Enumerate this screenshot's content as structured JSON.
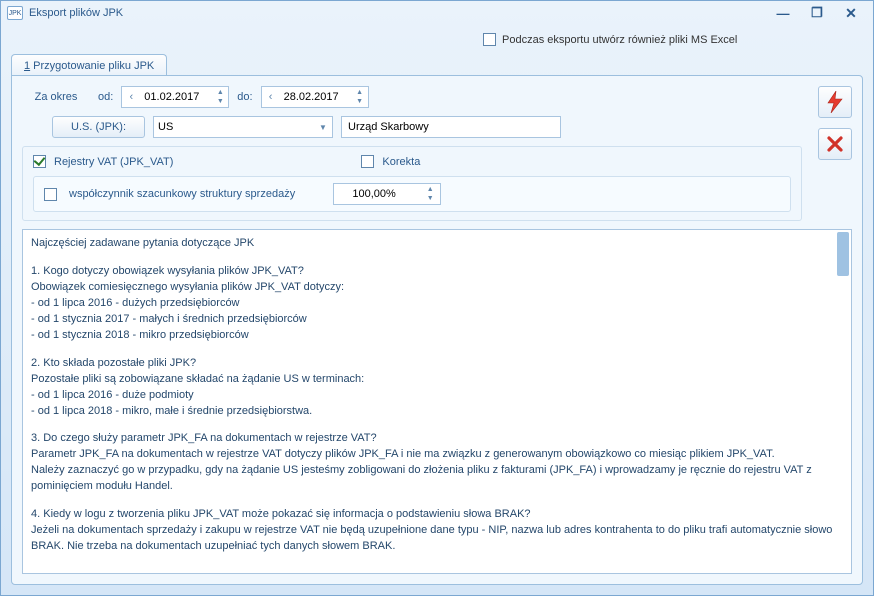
{
  "window": {
    "title": "Eksport plików JPK",
    "app_icon_text": "JPK"
  },
  "export_excel_label": "Podczas eksportu utwórz również pliki MS Excel",
  "tab": {
    "num": "1",
    "label": " Przygotowanie pliku JPK"
  },
  "period": {
    "label": "Za okres",
    "from_label": "od:",
    "from_value": "01.02.2017",
    "to_label": "do:",
    "to_value": "28.02.2017"
  },
  "us": {
    "button": "U.S. (JPK):",
    "code": "US",
    "name": "Urząd Skarbowy"
  },
  "registers": {
    "vat_label": "Rejestry VAT (JPK_VAT)",
    "correction_label": " Korekta",
    "ratio_label": "współczynnik szacunkowy struktury sprzedaży",
    "ratio_value": "100,00%"
  },
  "faq": {
    "heading": "Najczęściej zadawane pytania dotyczące JPK",
    "q1": {
      "title": "1. Kogo dotyczy obowiązek wysyłania plików JPK_VAT?",
      "l1": "Obowiązek comiesięcznego wysyłania plików JPK_VAT dotyczy:",
      "l2": "- od 1 lipca 2016 - dużych przedsiębiorców",
      "l3": "- od 1 stycznia 2017 - małych i średnich przedsiębiorców",
      "l4": "- od 1 stycznia 2018 - mikro przedsiębiorców"
    },
    "q2": {
      "title": "2. Kto składa pozostałe pliki JPK?",
      "l1": "Pozostałe pliki są zobowiązane składać na żądanie US w terminach:",
      "l2": "- od 1 lipca 2016 - duże podmioty",
      "l3": "- od 1 lipca 2018 - mikro, małe i średnie przedsiębiorstwa."
    },
    "q3": {
      "title": "3. Do czego służy parametr JPK_FA na dokumentach w rejestrze VAT?",
      "l1": "Parametr JPK_FA na dokumentach w rejestrze VAT dotyczy plików JPK_FA i nie ma związku z generowanym obowiązkowo co miesiąc plikiem JPK_VAT.",
      "l2": "Należy zaznaczyć go w przypadku, gdy na żądanie US jesteśmy zobligowani do złożenia pliku z fakturami (JPK_FA) i wprowadzamy je ręcznie do rejestru VAT z pominięciem modułu Handel."
    },
    "q4": {
      "title": "4. Kiedy w logu z tworzenia pliku JPK_VAT może pokazać się informacja o podstawieniu słowa BRAK?",
      "l1": "Jeżeli na dokumentach sprzedaży i zakupu w rejestrze VAT nie będą uzupełnione dane typu - NIP, nazwa lub adres kontrahenta to do pliku trafi automatycznie słowo BRAK. Nie trzeba na dokumentach uzupełniać tych danych słowem BRAK."
    }
  }
}
